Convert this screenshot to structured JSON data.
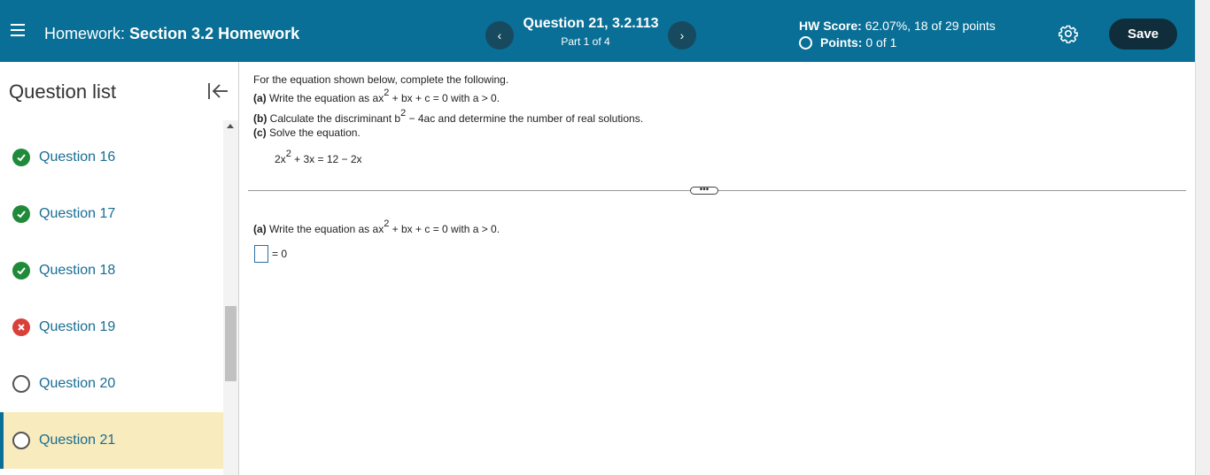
{
  "header": {
    "homework_label": "Homework:",
    "homework_title": "Section 3.2 Homework",
    "question_title": "Question 21, 3.2.113",
    "part": "Part 1 of 4",
    "prev_glyph": "‹",
    "next_glyph": "›",
    "hw_score_label": "HW Score:",
    "hw_score_value": "62.07%, 18 of 29 points",
    "points_label": "Points:",
    "points_value": "0 of 1",
    "save_label": "Save"
  },
  "sidebar": {
    "title": "Question list",
    "items": [
      {
        "label": "Question 16",
        "status": "correct"
      },
      {
        "label": "Question 17",
        "status": "correct"
      },
      {
        "label": "Question 18",
        "status": "correct"
      },
      {
        "label": "Question 19",
        "status": "incorrect"
      },
      {
        "label": "Question 20",
        "status": "unanswered"
      },
      {
        "label": "Question 21",
        "status": "unanswered-current"
      }
    ]
  },
  "question": {
    "intro": "For the equation shown below, complete the following.",
    "a_label": "(a)",
    "a_text": " Write the equation as ax",
    "a_rest": " + bx + c = 0 with a > 0.",
    "b_label": "(b)",
    "b_text": " Calculate the discriminant b",
    "b_rest": " − 4ac and determine the number of real solutions.",
    "c_label": "(c)",
    "c_text": " Solve the equation.",
    "exp": "2",
    "eq_left": "2x",
    "eq_rest": " + 3x = 12 − 2x",
    "dots": "•••",
    "answer_prompt_label": "(a)",
    "answer_prompt_text": " Write the equation as ax",
    "answer_prompt_rest": " + bx + c = 0 with a > 0.",
    "answer_suffix": "= 0"
  },
  "colors": {
    "header_bg": "#0a6f96",
    "save_bg": "#0f2d3a",
    "correct": "#1f8a3a",
    "incorrect": "#d9403a",
    "active_row": "#f8ebbd",
    "link": "#1a6d92"
  },
  "icons": [
    "menu-icon",
    "chevron-left-icon",
    "chevron-right-icon",
    "circle-icon",
    "gear-icon",
    "collapse-left-icon",
    "check-icon",
    "x-icon"
  ]
}
